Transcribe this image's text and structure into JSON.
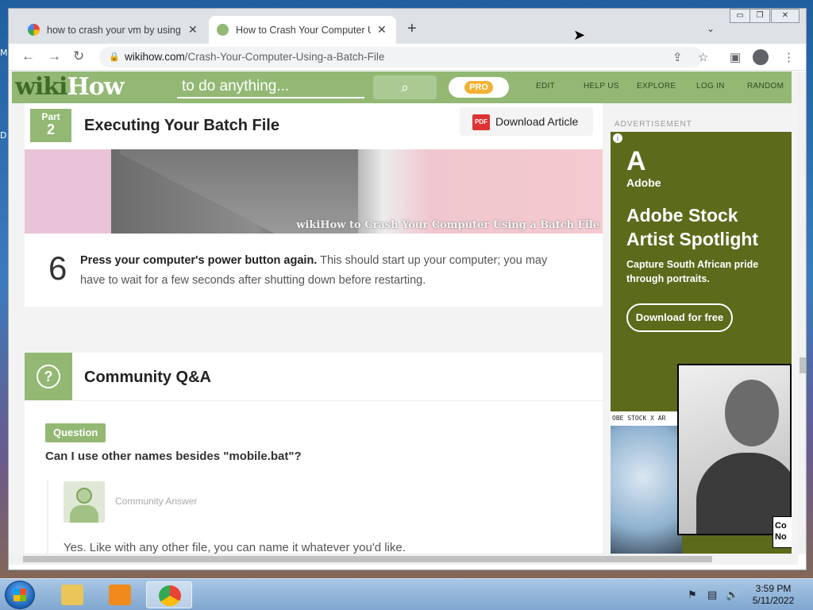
{
  "desktop": {
    "side_letters": [
      "M",
      "D"
    ]
  },
  "browser": {
    "tabs": [
      {
        "title": "how to crash your vm by using c",
        "close": "✕"
      },
      {
        "title": "How to Crash Your Computer Usi",
        "close": "✕"
      }
    ],
    "new_tab": "+",
    "tab_menu": "⌄",
    "window_controls": [
      "▭",
      "❐",
      "✕"
    ],
    "back": "←",
    "forward": "→",
    "reload": "↻",
    "url_host": "wikihow.com",
    "url_path": "/Crash-Your-Computer-Using-a-Batch-File",
    "share_icon": "⇪",
    "star_icon": "☆",
    "sidepanel_icon": "▣",
    "menu_icon": "⋮"
  },
  "wikihow": {
    "logo_wiki": "wiki",
    "logo_how": "How",
    "search_placeholder": "to do anything...",
    "search_icon": "⌕",
    "pro": "PRO",
    "nav": [
      "EDIT",
      "HELP US",
      "EXPLORE",
      "LOG IN",
      "RANDOM"
    ]
  },
  "article": {
    "part_label": "Part",
    "part_number": "2",
    "part_title": "Executing Your Batch File",
    "download_label": "Download Article",
    "pdf_icon_text": "PDF",
    "image_caption": "wikiHow to Crash Your Computer Using a Batch File",
    "step_number": "6",
    "step_bold": "Press your computer's power button again.",
    "step_rest": " This should start up your computer; you may have to wait for a few seconds after shutting down before restarting."
  },
  "qa": {
    "title": "Community Q&A",
    "icon": "?",
    "question_badge": "Question",
    "question": "Can I use other names besides \"mobile.bat\"?",
    "answer_label": "Community Answer",
    "answer": "Yes. Like with any other file, you can name it whatever you'd like."
  },
  "ad": {
    "label": "ADVERTISEMENT",
    "info_icon": "i",
    "brand_logo": "A",
    "brand": "Adobe",
    "headline": "Adobe Stock Artist Spotlight",
    "subtext": "Capture South African pride through portraits.",
    "cta": "Download for free",
    "strip_text": "OBE STOCK  X  AR",
    "corner_text": "Co No"
  },
  "taskbar": {
    "time": "3:59 PM",
    "date": "5/11/2022",
    "tray": [
      "⚑",
      "▤",
      "🔊"
    ]
  },
  "colors": {
    "wikihow_green": "#93b874",
    "ad_olive": "#5c6a1c",
    "chrome_tabstrip": "#dee1e6"
  }
}
